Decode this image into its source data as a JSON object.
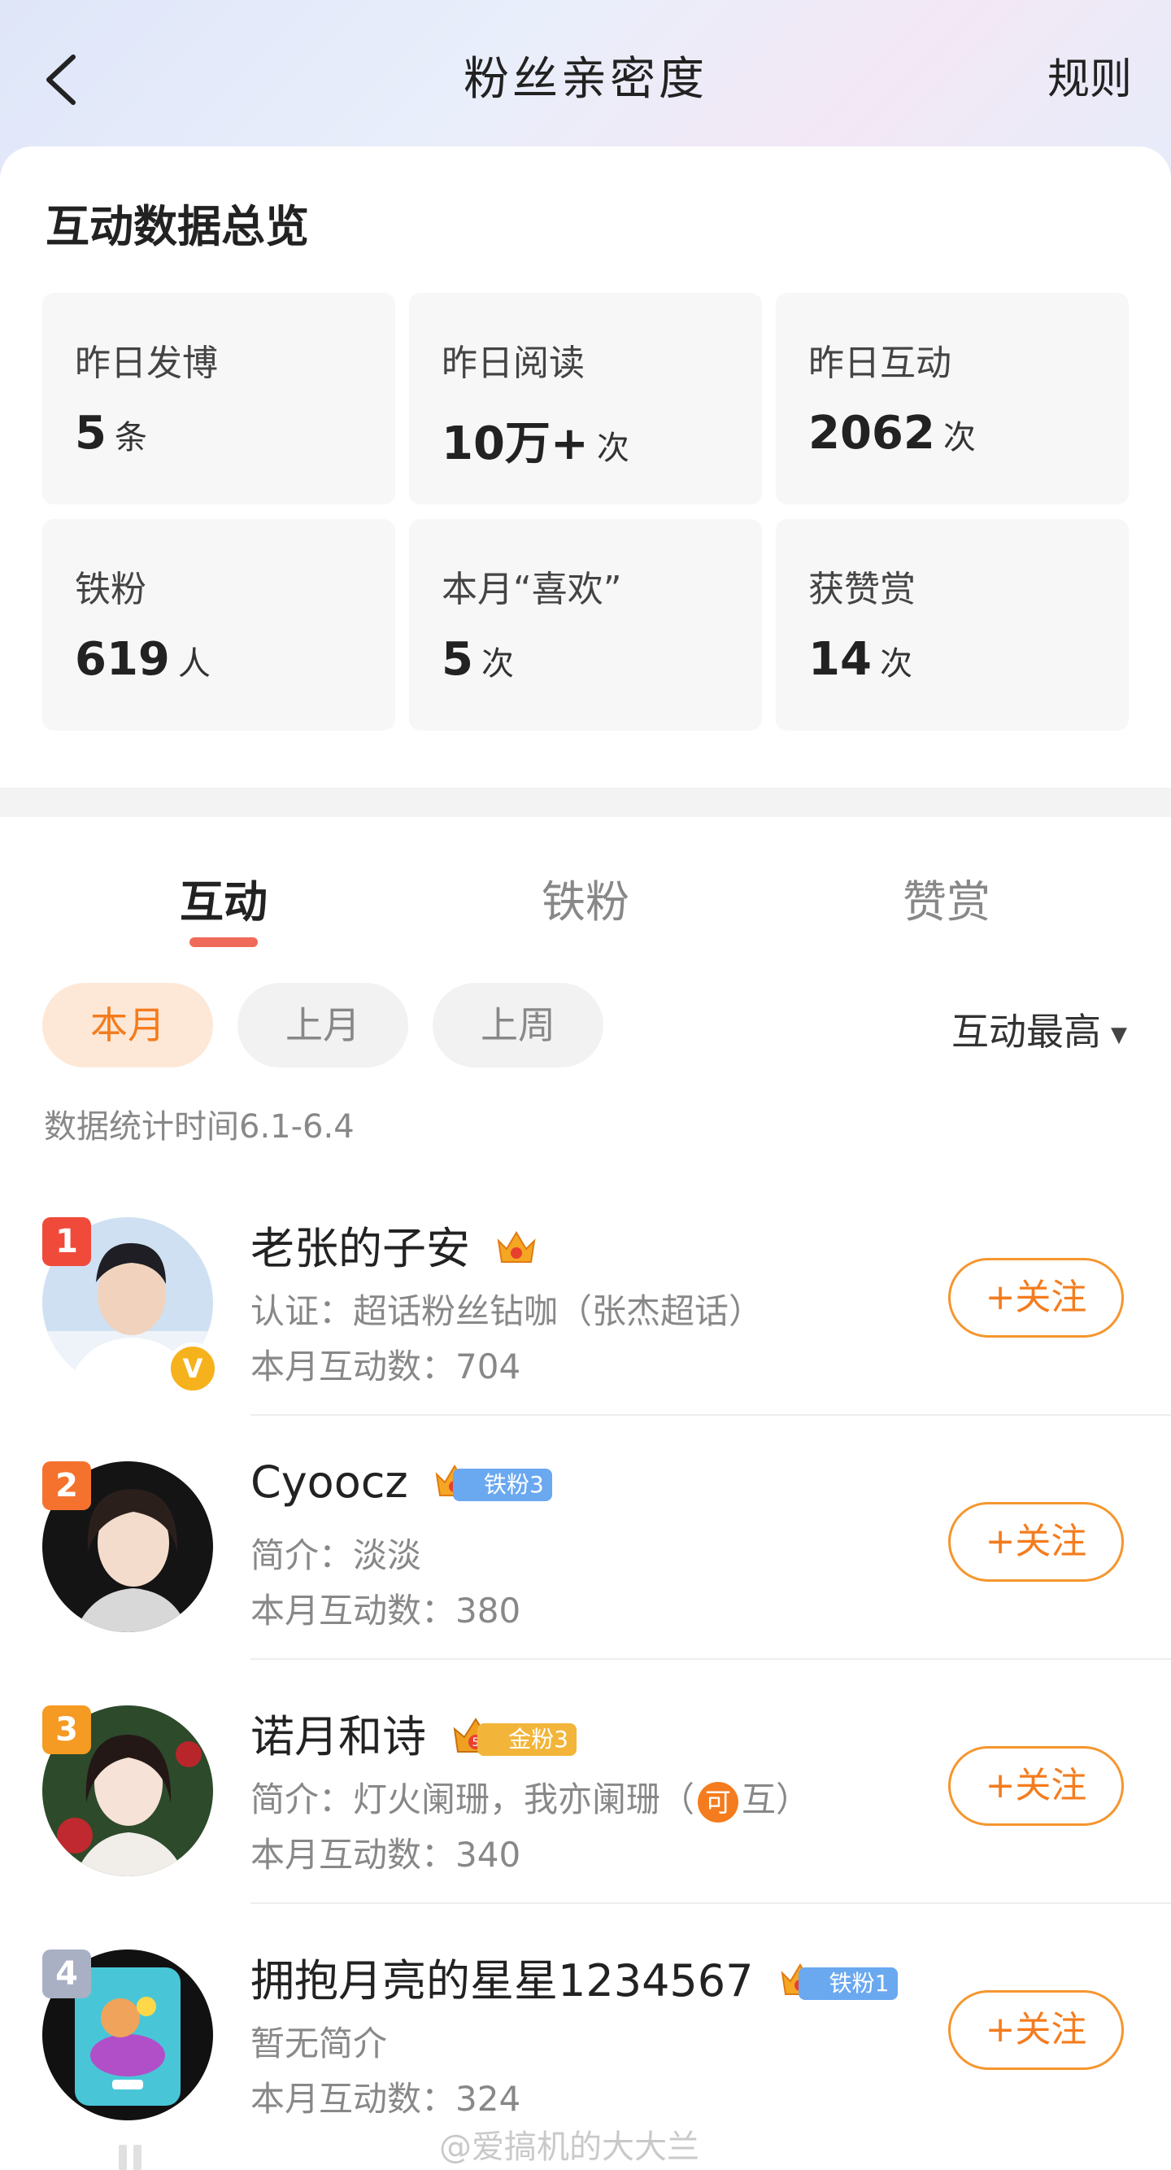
{
  "nav": {
    "title": "粉丝亲密度",
    "rules": "规则"
  },
  "overview": {
    "title": "互动数据总览",
    "stats": [
      {
        "label": "昨日发博",
        "value": "5",
        "unit": "条"
      },
      {
        "label": "昨日阅读",
        "value": "10万+",
        "unit": "次"
      },
      {
        "label": "昨日互动",
        "value": "2062",
        "unit": "次"
      },
      {
        "label": "铁粉",
        "value": "619",
        "unit": "人"
      },
      {
        "label": "本月“喜欢”",
        "value": "5",
        "unit": "次"
      },
      {
        "label": "获赞赏",
        "value": "14",
        "unit": "次"
      }
    ]
  },
  "tabs": [
    {
      "label": "互动",
      "active": true
    },
    {
      "label": "铁粉",
      "active": false
    },
    {
      "label": "赞赏",
      "active": false
    }
  ],
  "filters": {
    "pills": [
      {
        "label": "本月",
        "active": true
      },
      {
        "label": "上月",
        "active": false
      },
      {
        "label": "上周",
        "active": false
      }
    ],
    "sort": "互动最高"
  },
  "date_range": "数据统计时间6.1-6.4",
  "fans": [
    {
      "rank": "1",
      "rank_color": "#f04a3a",
      "name": "老张的子安",
      "crown_level": "",
      "tag": "",
      "desc": "认证：超话粉丝钻咖（张杰超话）",
      "count": "本月互动数：704",
      "follow": "+关注",
      "verified": "V"
    },
    {
      "rank": "2",
      "rank_color": "#f5722e",
      "name": "Cyoocz",
      "crown_level": "",
      "tag": "铁粉3",
      "tag_color": "#6aa8f0",
      "desc": "简介：淡淡",
      "count": "本月互动数：380",
      "follow": "+关注"
    },
    {
      "rank": "3",
      "rank_color": "#f59a22",
      "name": "诺月和诗",
      "crown_level": "5",
      "tag": "金粉3",
      "tag_color": "#f2b53a",
      "desc_prefix": "简介：灯火阑珊，我亦阑珊（",
      "desc_chip": "可",
      "desc_suffix": "互）",
      "count": "本月互动数：340",
      "follow": "+关注"
    },
    {
      "rank": "4",
      "rank_color": "#aab0c4",
      "name": "拥抱月亮的星星1234567",
      "crown_level": "",
      "tag": "铁粉1",
      "tag_color": "#6aa8f0",
      "desc": "暂无简介",
      "count": "本月互动数：324",
      "follow": "+关注"
    }
  ],
  "watermark": "@爱搞机的大大兰",
  "colors": {
    "accent": "#f47c1e",
    "tab_underline": "#f06a5a"
  }
}
